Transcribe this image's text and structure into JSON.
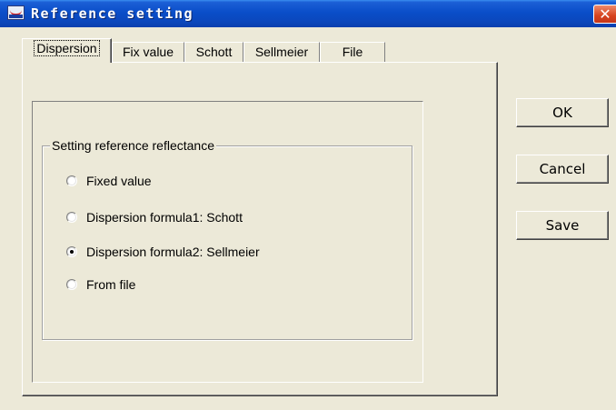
{
  "window": {
    "title": "Reference setting",
    "close_glyph": "✕"
  },
  "tabs": [
    {
      "label": "Dispersion",
      "active": true
    },
    {
      "label": "Fix value",
      "active": false
    },
    {
      "label": "Schott",
      "active": false
    },
    {
      "label": "Sellmeier",
      "active": false
    },
    {
      "label": "File",
      "active": false
    }
  ],
  "group": {
    "title": "Setting reference reflectance",
    "options": [
      {
        "label": "Fixed value",
        "checked": false
      },
      {
        "label": "Dispersion formula1: Schott",
        "checked": false
      },
      {
        "label": "Dispersion formula2: Sellmeier",
        "checked": true
      },
      {
        "label": "From file",
        "checked": false
      }
    ]
  },
  "buttons": {
    "ok": "OK",
    "cancel": "Cancel",
    "save": "Save"
  },
  "colors": {
    "dialog_bg": "#ece9d8",
    "titlebar": "#0a4ec9",
    "close_button": "#d6431e"
  }
}
